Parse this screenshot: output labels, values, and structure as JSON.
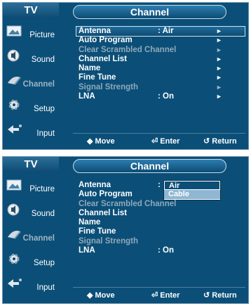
{
  "panel_top": {
    "tv_label": "TV",
    "title": "Channel",
    "sidebar": [
      {
        "label": "Picture",
        "icon": "picture-icon"
      },
      {
        "label": "Sound",
        "icon": "sound-icon"
      },
      {
        "label": "Channel",
        "icon": "channel-icon",
        "active": true
      },
      {
        "label": "Setup",
        "icon": "setup-icon"
      },
      {
        "label": "Input",
        "icon": "input-icon"
      }
    ],
    "menu": [
      {
        "label": "Antenna",
        "value": ": Air",
        "arrow": "►"
      },
      {
        "label": "Auto Program",
        "value": "",
        "arrow": "►"
      },
      {
        "label": "Clear Scrambled Channel",
        "value": "",
        "arrow": "►"
      },
      {
        "label": "Channel List",
        "value": "",
        "arrow": "►"
      },
      {
        "label": "Name",
        "value": "",
        "arrow": "►"
      },
      {
        "label": "Fine Tune",
        "value": "",
        "arrow": "►"
      },
      {
        "label": "Signal Strength",
        "value": "",
        "arrow": "►"
      },
      {
        "label": "LNA",
        "value": ": On",
        "arrow": "►"
      }
    ],
    "footer": {
      "move": "◆ Move",
      "enter": "⏎ Enter",
      "return": "↺ Return"
    }
  },
  "panel_bottom": {
    "tv_label": "TV",
    "title": "Channel",
    "menu": [
      {
        "label": "Antenna",
        "value": ":"
      },
      {
        "label": "Auto Program",
        "value": ""
      },
      {
        "label": "Clear Scrambled Channel",
        "value": ""
      },
      {
        "label": "Channel List",
        "value": ""
      },
      {
        "label": "Name",
        "value": ""
      },
      {
        "label": "Fine Tune",
        "value": ""
      },
      {
        "label": "Signal Strength",
        "value": ""
      },
      {
        "label": "LNA",
        "value": ": On"
      }
    ],
    "dropdown": {
      "options": [
        "Air",
        "Cable"
      ],
      "selected": "Air"
    },
    "footer": {
      "move": "◆ Move",
      "enter": "⏎ Enter",
      "return": "↺ Return"
    }
  },
  "colors": {
    "panel_bg": "#0b4f78",
    "highlight": "#1f6b9c",
    "dim_text": "#8fa8b8"
  }
}
